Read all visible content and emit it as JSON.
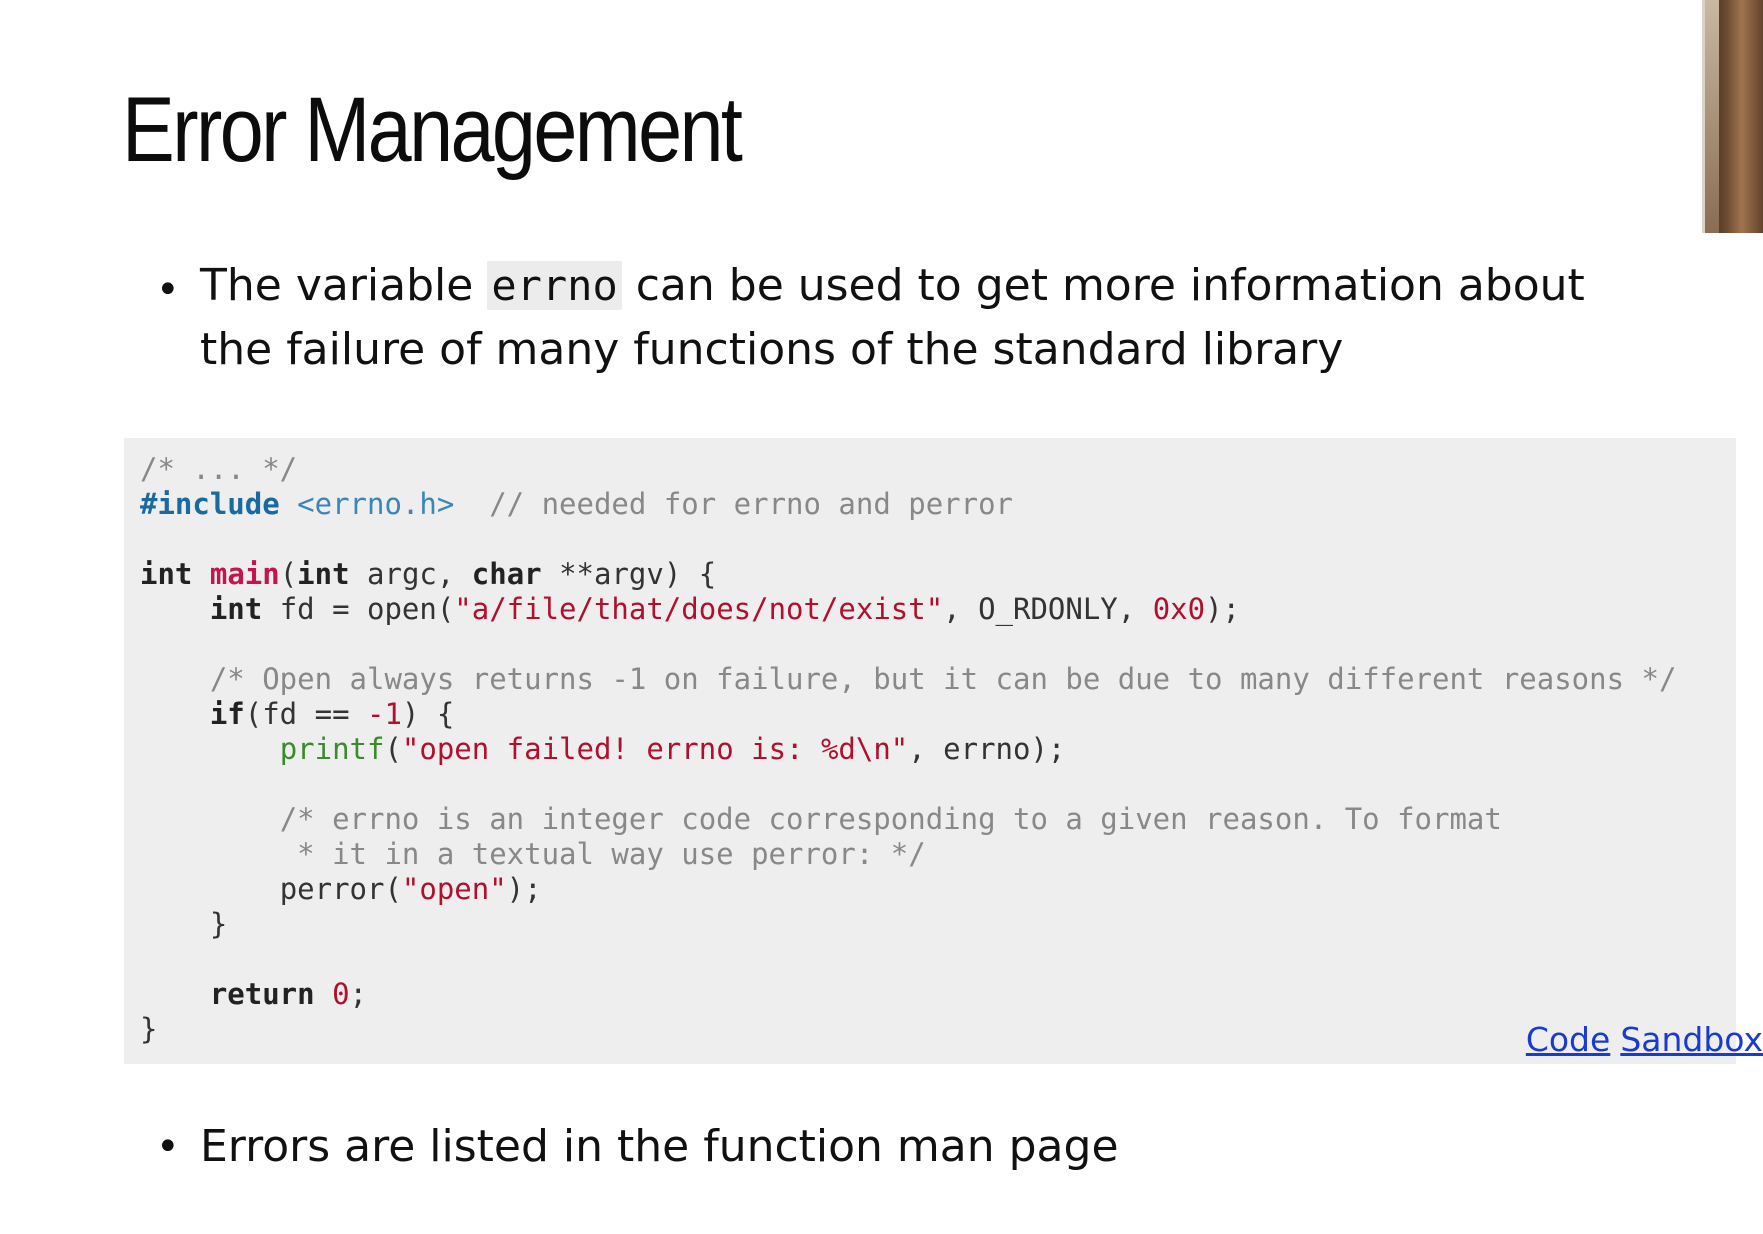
{
  "slide": {
    "title": "Error Management",
    "bullet1": {
      "before": "The variable ",
      "code": "errno",
      "after": " can be used to get more information about the failure of many functions of the standard library"
    },
    "bullet2": "Errors are listed in the function man page",
    "bullet_symbol": "•"
  },
  "code": {
    "l1_comment": "/* ... */",
    "l2_pp": "#include",
    "l2_inc": "<errno.h>",
    "l2_comment": "// needed for errno and perror",
    "l4_int": "int",
    "l4_main": "main",
    "l4_a": "(",
    "l4_int2": "int",
    "l4_b": " argc, ",
    "l4_char": "char",
    "l4_c": " **argv) {",
    "l5_int": "int",
    "l5_a": " fd = open(",
    "l5_str": "\"a/file/that/does/not/exist\"",
    "l5_b": ", O_RDONLY, ",
    "l5_num": "0x0",
    "l5_c": ");",
    "l7_comment": "/* Open always returns -1 on failure, but it can be due to many different reasons */",
    "l8_if": "if",
    "l8_a": "(fd == ",
    "l8_num": "-1",
    "l8_b": ") {",
    "l9_printf": "printf",
    "l9_a": "(",
    "l9_str": "\"open failed! errno is: %d\\n\"",
    "l9_b": ", errno);",
    "l11_comment": "/* errno is an integer code corresponding to a given reason. To format",
    "l12_comment": " * it in a textual way use perror: */",
    "l13_a": "perror(",
    "l13_str": "\"open\"",
    "l13_b": ");",
    "l14": "}",
    "l16_return": "return",
    "l16_num": "0",
    "l16_a": ";",
    "l17": "}"
  },
  "links": {
    "code": "Code",
    "sandbox": "Sandbox"
  },
  "colors": {
    "code_background": "#eeeeee",
    "link": "#1a3bd0",
    "string": "#b0102e",
    "keyword_function": "#c2154f",
    "include": "#1a6aa2",
    "builtin": "#3b8a2e",
    "comment": "#888888"
  }
}
